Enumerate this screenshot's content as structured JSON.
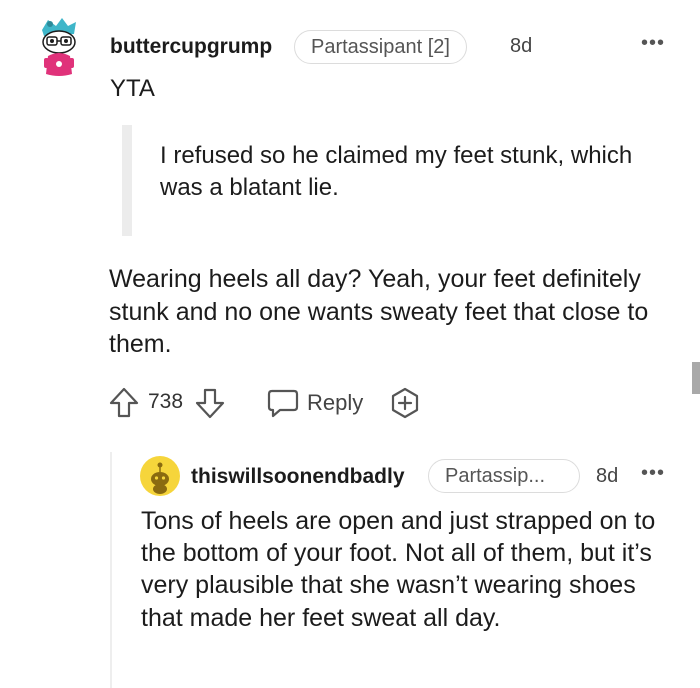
{
  "comment1": {
    "username": "buttercupgrump",
    "flair": "Partassipant [2]",
    "time": "8d",
    "more": "•••",
    "verdict": "YTA",
    "quote": "I refused so he claimed my feet stunk, which was a blatant lie.",
    "body": "Wearing heels all day? Yeah, your feet definitely stunk and no one wants sweaty feet that close to them.",
    "score": "738",
    "reply_label": "Reply"
  },
  "comment2": {
    "username": "thiswillsoonendbadly",
    "flair": "Partassip...",
    "time": "8d",
    "more": "•••",
    "body": "Tons of heels are open and just strapped on to the bottom of your foot. Not all of them, but it’s very plausible that she wasn’t wearing shoes that made her feet sweat all day."
  },
  "colors": {
    "text": "#1c1c1c",
    "muted": "#555555",
    "border": "#dcdcdc",
    "quote_bar": "#ececec",
    "avatar2_bg": "#f6d53b"
  },
  "icons": {
    "upvote": "upvote-arrow-icon",
    "downvote": "downvote-arrow-icon",
    "reply": "speech-bubble-icon",
    "award": "award-plus-icon",
    "more": "more-dots-icon"
  }
}
